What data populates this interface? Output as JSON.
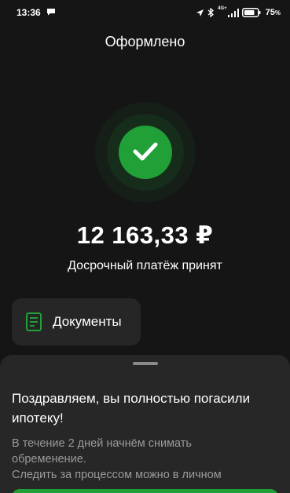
{
  "status_bar": {
    "time": "13:36",
    "network": "4G+",
    "battery": "75",
    "icons": [
      "chat-icon",
      "location-icon",
      "bluetooth-icon",
      "signal-icon",
      "battery-icon"
    ]
  },
  "header": {
    "title": "Оформлено"
  },
  "success": {
    "icon": "check-icon",
    "color": "#21a038",
    "amount": "12 163,33 ₽",
    "message": "Досрочный платёж принят"
  },
  "documents_button": {
    "icon": "document-icon",
    "label": "Документы"
  },
  "sheet": {
    "heading": "Поздравляем, вы полностью погасили ипотеку!",
    "body_lines": [
      "В течение 2 дней начнём снимать",
      "обременение.",
      "Следить за процессом можно в личном"
    ]
  },
  "colors": {
    "background": "#151515",
    "card": "#262626",
    "sheet": "#272727",
    "accent": "#21a038"
  }
}
